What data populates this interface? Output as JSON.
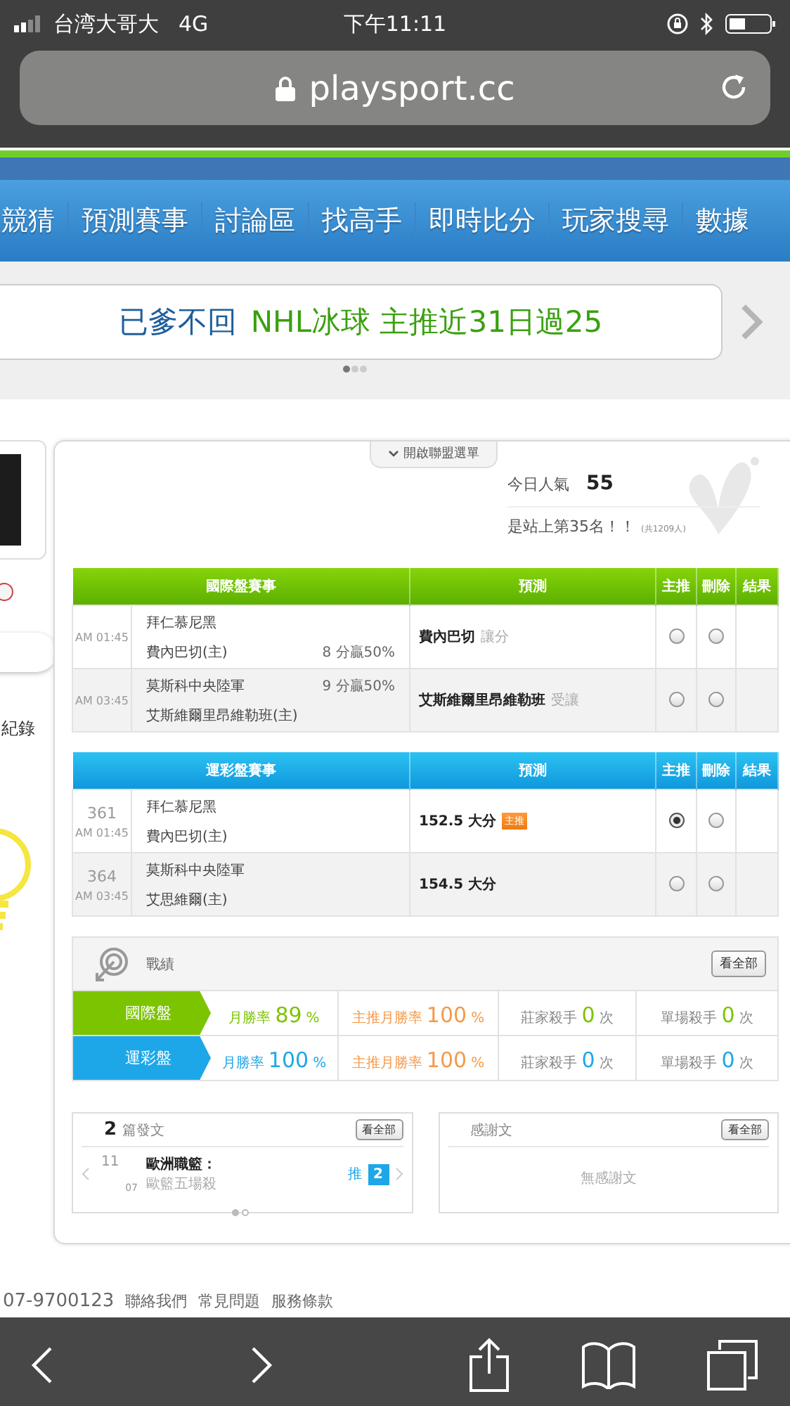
{
  "status_bar": {
    "carrier": "台湾大哥大",
    "network": "4G",
    "time": "下午11:11"
  },
  "browser": {
    "url": "playsport.cc"
  },
  "nav": {
    "items": [
      "競猜",
      "預測賽事",
      "討論區",
      "找高手",
      "即時比分",
      "玩家搜尋",
      "數據"
    ]
  },
  "promo": {
    "author": "已爹不回",
    "headline": "NHL冰球 主推近31日過25",
    "pages": [
      {
        "selected": true
      },
      {
        "selected": false
      },
      {
        "selected": false
      }
    ]
  },
  "sidebar": {
    "record_label": "紀錄"
  },
  "league_menu": {
    "label": "開啟聯盟選單"
  },
  "popularity": {
    "label": "今日人氣",
    "value": "55",
    "rank": "是站上第35名！！",
    "total": "(共1209人)"
  },
  "tables": [
    {
      "kind": "intl",
      "columns": [
        "國際盤賽事",
        "預測",
        "主推",
        "刪除",
        "結果"
      ],
      "rows": [
        {
          "time": "AM 01:45",
          "teams": [
            {
              "name": "拜仁慕尼黑"
            },
            {
              "name": "費內巴切(主)",
              "note": "8 分贏50%"
            }
          ],
          "pick": "費內巴切",
          "pick_type": "讓分",
          "recommended": false,
          "deleted": false
        },
        {
          "time": "AM 03:45",
          "teams": [
            {
              "name": "莫斯科中央陸軍",
              "note": "9 分贏50%"
            },
            {
              "name": "艾斯維爾里昂維勒班(主)"
            }
          ],
          "pick": "艾斯維爾里昂維勒班",
          "pick_type": "受讓",
          "recommended": false,
          "deleted": false
        }
      ]
    },
    {
      "kind": "lottery",
      "columns": [
        "運彩盤賽事",
        "預測",
        "主推",
        "刪除",
        "結果"
      ],
      "rows": [
        {
          "number": "361",
          "time": "AM 01:45",
          "teams": [
            {
              "name": "拜仁慕尼黑"
            },
            {
              "name": "費內巴切(主)"
            }
          ],
          "pick": "152.5 大分",
          "badge": "主推",
          "recommended": true,
          "deleted": false
        },
        {
          "number": "364",
          "time": "AM 03:45",
          "teams": [
            {
              "name": "莫斯科中央陸軍"
            },
            {
              "name": "艾思維爾(主)"
            }
          ],
          "pick": "154.5 大分",
          "recommended": false,
          "deleted": false
        }
      ]
    }
  ],
  "record": {
    "title": "戰績",
    "button": "看全部",
    "rows": [
      {
        "kind": "intl",
        "label": "國際盤",
        "cells": [
          {
            "kind": "rate",
            "label": "月勝率",
            "value": "89",
            "unit": "%"
          },
          {
            "kind": "main",
            "label": "主推月勝率",
            "value": "100",
            "unit": "%"
          },
          {
            "kind": "killer",
            "label": "莊家殺手",
            "value": "0",
            "unit": "次"
          },
          {
            "kind": "killer",
            "label": "單場殺手",
            "value": "0",
            "unit": "次"
          }
        ]
      },
      {
        "kind": "lottery",
        "label": "運彩盤",
        "cells": [
          {
            "kind": "rate",
            "label": "月勝率",
            "value": "100",
            "unit": "%"
          },
          {
            "kind": "main",
            "label": "主推月勝率",
            "value": "100",
            "unit": "%"
          },
          {
            "kind": "killer",
            "label": "莊家殺手",
            "value": "0",
            "unit": "次"
          },
          {
            "kind": "killer",
            "label": "單場殺手",
            "value": "0",
            "unit": "次"
          }
        ]
      }
    ]
  },
  "posts": {
    "count": "2",
    "label": "篇發文",
    "button": "看全部",
    "item": {
      "month": "11",
      "day": "07",
      "title": "歐洲職籃：",
      "subtitle": "歐籃五場殺",
      "push_label": "推",
      "push_count": "2"
    },
    "pages": [
      {
        "selected": true
      },
      {
        "selected": false
      }
    ]
  },
  "thanks": {
    "title": "感謝文",
    "button": "看全部",
    "empty": "無感謝文"
  },
  "footer": {
    "phone": "07-9700123",
    "links": [
      "聯絡我們",
      "常見問題",
      "服務條款"
    ]
  }
}
